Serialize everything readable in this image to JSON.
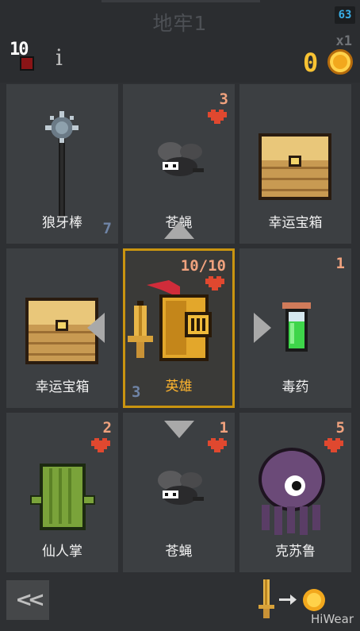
{
  "header": {
    "title": "地牢1",
    "fps": "63",
    "hp": "10",
    "info_label": "i",
    "multiplier": "x1",
    "gold": "0"
  },
  "cards": [
    {
      "name": "狼牙棒",
      "cost": "",
      "durability": "7",
      "icon": "mace-icon"
    },
    {
      "name": "苍蝇",
      "cost": "3",
      "durability": "",
      "icon": "fly-icon"
    },
    {
      "name": "幸运宝箱",
      "cost": "",
      "durability": "",
      "icon": "chest-icon"
    },
    {
      "name": "幸运宝箱",
      "cost": "",
      "durability": "",
      "icon": "chest-icon"
    },
    {
      "name": "英雄",
      "cost": "10/10",
      "durability": "3",
      "icon": "knight-icon"
    },
    {
      "name": "毒药",
      "cost": "1",
      "durability": "",
      "icon": "potion-icon"
    },
    {
      "name": "仙人掌",
      "cost": "2",
      "durability": "",
      "icon": "cactus-icon"
    },
    {
      "name": "苍蝇",
      "cost": "1",
      "durability": "",
      "icon": "fly-icon"
    },
    {
      "name": "克苏鲁",
      "cost": "5",
      "durability": "",
      "icon": "cthulhu-icon"
    }
  ],
  "footer": {
    "back_label": "<<",
    "exchange_icon": "sword-to-coin-icon",
    "watermark": "HiWear"
  },
  "colors": {
    "hero_border": "#c99410",
    "gold": "#f7c233",
    "cost": "#f0a27e",
    "heart": "#e0482f"
  }
}
